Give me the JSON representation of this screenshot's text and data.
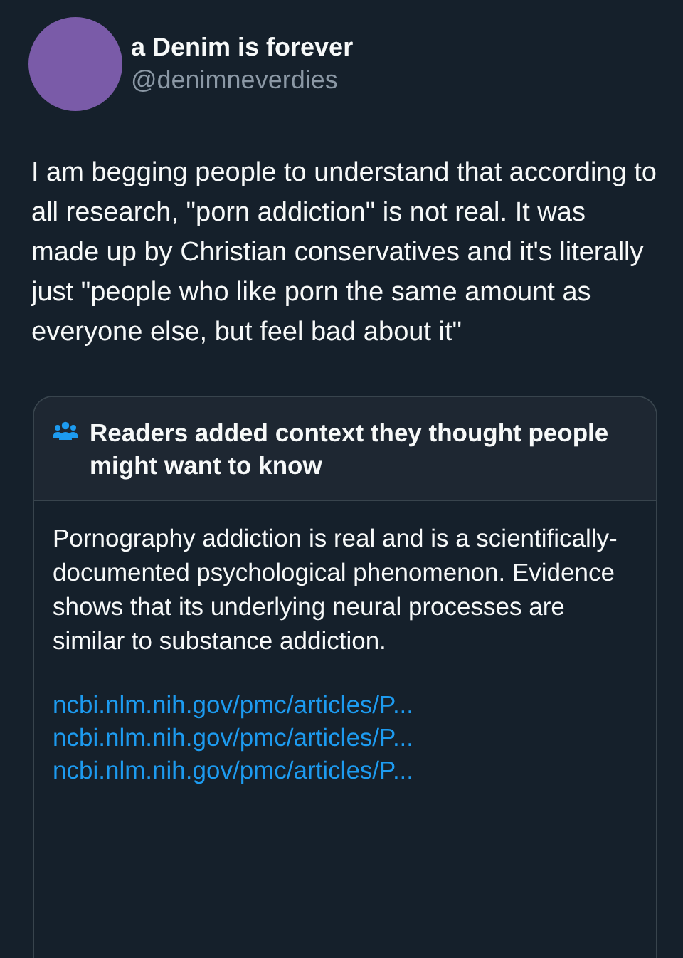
{
  "author": {
    "name": "a Denim is forever",
    "handle": "@denimneverdies"
  },
  "tweet_text": "I am begging people to understand that according to all research, \"porn addiction\" is not real. It was made up by Christian conservatives and it's literally just \"people who like porn the same amount as everyone else, but feel bad about it\"",
  "community_note": {
    "title": "Readers added context they thought people might want to know",
    "text": "Pornography addiction is real and is a scientifically-documented psychological phenomenon. Evidence shows that its underlying neural processes are similar to substance addiction.",
    "links": [
      "ncbi.nlm.nih.gov/pmc/articles/P...",
      "ncbi.nlm.nih.gov/pmc/articles/P...",
      "ncbi.nlm.nih.gov/pmc/articles/P..."
    ]
  }
}
